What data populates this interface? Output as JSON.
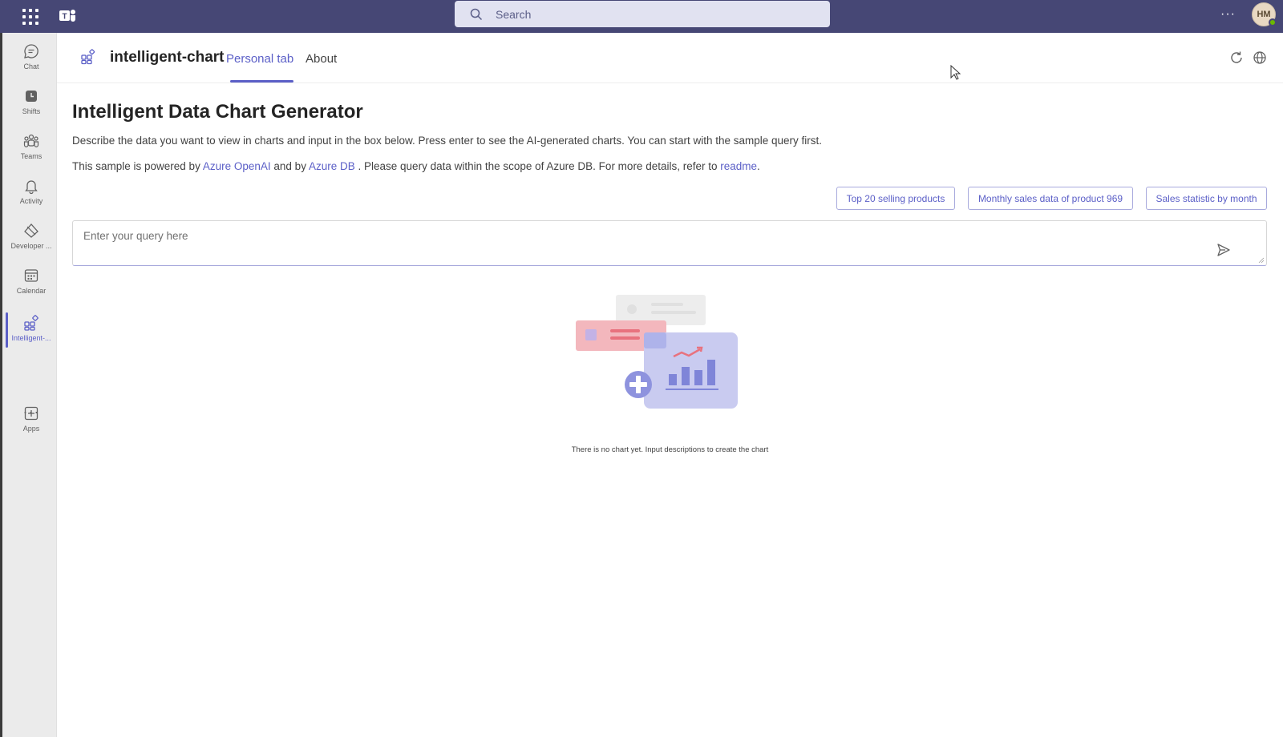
{
  "topbar": {
    "search_placeholder": "Search",
    "more": "···",
    "avatar_initials": "HM"
  },
  "rail": {
    "items": [
      {
        "label": "Chat",
        "icon": "chat-icon"
      },
      {
        "label": "Shifts",
        "icon": "shifts-icon"
      },
      {
        "label": "Teams",
        "icon": "teams-icon"
      },
      {
        "label": "Activity",
        "icon": "bell-icon"
      },
      {
        "label": "Developer ...",
        "icon": "developer-portal-icon"
      },
      {
        "label": "Calendar",
        "icon": "calendar-icon"
      },
      {
        "label": "Intelligent-...",
        "icon": "app-grid-icon",
        "active": true
      },
      {
        "label": "Apps",
        "icon": "add-apps-icon"
      }
    ],
    "more": "···"
  },
  "header": {
    "app_title": "intelligent-chart",
    "tabs": [
      {
        "label": "Personal tab",
        "active": true
      },
      {
        "label": "About",
        "active": false
      }
    ]
  },
  "main": {
    "title": "Intelligent Data Chart Generator",
    "description": "Describe the data you want to view in charts and input in the box below. Press enter to see the AI-generated charts. You can start with the sample query first.",
    "powered": {
      "prefix": "This sample is powered by",
      "link1": "Azure OpenAI",
      "middle": "and by",
      "link2": "Azure DB",
      "suffix": ". Please query data within the scope of Azure DB. For more details, refer to",
      "link3": "readme",
      "end": "."
    },
    "sample_queries": [
      "Top 20 selling products",
      "Monthly sales data of product 969",
      "Sales statistic by month"
    ],
    "query_placeholder": "Enter your query here",
    "empty_message": "There is no chart yet. Input descriptions to create the chart"
  },
  "colors": {
    "topbar": "#464775",
    "accent": "#5b5fc7",
    "rail_bg": "#ebebeb"
  }
}
